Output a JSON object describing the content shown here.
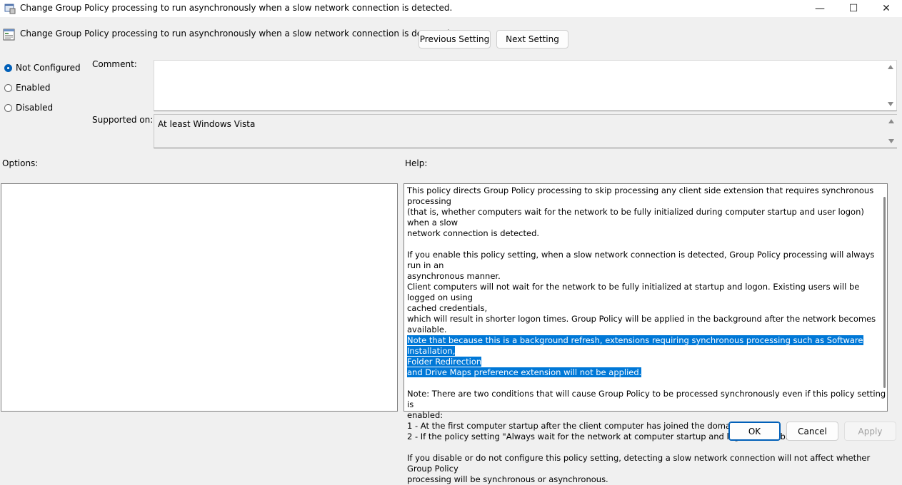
{
  "window": {
    "title": "Change Group Policy processing to run asynchronously when a slow network connection is detected.",
    "minimize_glyph": "—",
    "maximize_glyph": "☐",
    "close_glyph": "✕"
  },
  "header": {
    "setting_name": "Change Group Policy processing to run asynchronously when a slow network connection is detected.",
    "previous_label": "Previous Setting",
    "next_label": "Next Setting"
  },
  "state": {
    "options": [
      {
        "label": "Not Configured",
        "checked": true
      },
      {
        "label": "Enabled",
        "checked": false
      },
      {
        "label": "Disabled",
        "checked": false
      }
    ]
  },
  "comment": {
    "label": "Comment:",
    "value": ""
  },
  "supported": {
    "label": "Supported on:",
    "value": "At least Windows Vista"
  },
  "options_label": "Options:",
  "help": {
    "label": "Help:",
    "lines": {
      "l1": "This policy directs Group Policy processing to skip processing any client side extension that requires synchronous processing",
      "l2": "(that is, whether computers wait for the network to be fully initialized during computer startup and user logon) when a slow",
      "l3": "network connection is detected.",
      "l4": "If you enable this policy setting, when a slow network connection is detected, Group Policy processing will always run in an",
      "l5": "asynchronous manner.",
      "l6": "Client computers will not wait for the network to be fully initialized at startup and logon. Existing users will be logged on using",
      "l7": "cached credentials,",
      "l8": "which will result in shorter logon times. Group Policy will be applied in the background after the network becomes available.",
      "l9": "Note that because this is a background refresh, extensions requiring synchronous processing such as Software Installation,",
      "l10": "Folder Redirection",
      "l11": "and Drive Maps preference extension will not be applied.",
      "l12": "Note: There are two conditions that will cause Group Policy to be processed synchronously even if this policy setting is",
      "l13": "enabled:",
      "l14": "1 - At the first computer startup after the client computer has joined the domain.",
      "l15": "2 - If the policy setting \"Always wait for the network at computer startup and logon\" is enabled.",
      "l16": "If you disable or do not configure this policy setting, detecting a slow network connection will not affect whether Group Policy",
      "l17": "processing will be synchronous or asynchronous."
    }
  },
  "footer": {
    "ok_label": "OK",
    "cancel_label": "Cancel",
    "apply_label": "Apply"
  },
  "colors": {
    "accent": "#005fb8",
    "selection": "#0078d7"
  }
}
